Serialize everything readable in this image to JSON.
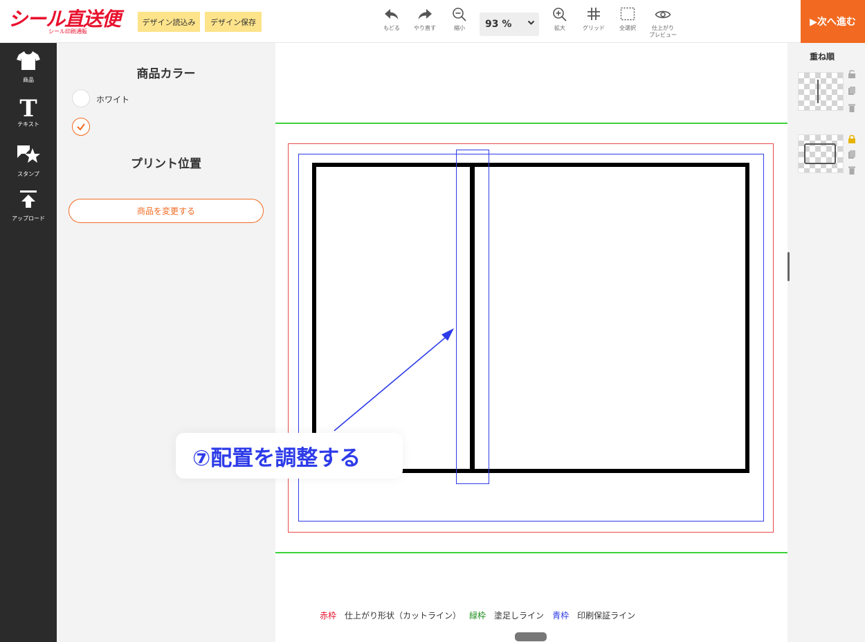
{
  "app": {
    "logo_text": "シール直送便",
    "logo_sub": "シール印刷通販"
  },
  "toolbar": {
    "load_design": "デザイン読込み",
    "save_design": "デザイン保存",
    "undo": "もどる",
    "redo": "やり直す",
    "zoom_out": "縮小",
    "zoom_value": "93 %",
    "zoom_in": "拡大",
    "grid": "グリッド",
    "select_all": "全選択",
    "preview_line1": "仕上がり",
    "preview_line2": "プレビュー",
    "next": "▶次へ進む"
  },
  "left_nav": {
    "product": "商品",
    "text": "テキスト",
    "stamp": "スタンプ",
    "upload": "アップロード"
  },
  "settings": {
    "color_heading": "商品カラー",
    "color_white": "ホワイト",
    "position_heading": "プリント位置",
    "change_product": "商品を変更する"
  },
  "canvas": {
    "annotation": "⑦配置を調整する",
    "legend": {
      "red_label": "赤枠",
      "red_desc": "仕上がり形状（カットライン）",
      "green_label": "緑枠",
      "green_desc": "塗足しライン",
      "blue_label": "青枠",
      "blue_desc": "印刷保証ライン"
    }
  },
  "layers": {
    "title": "重ね順"
  },
  "colors": {
    "accent": "#f26a21",
    "brand_red": "#e8112d",
    "cut_line": "#e84a4a",
    "bleed_line": "#3ad33a",
    "safe_line": "#2d3be8",
    "button_yellow": "#fde38a"
  }
}
